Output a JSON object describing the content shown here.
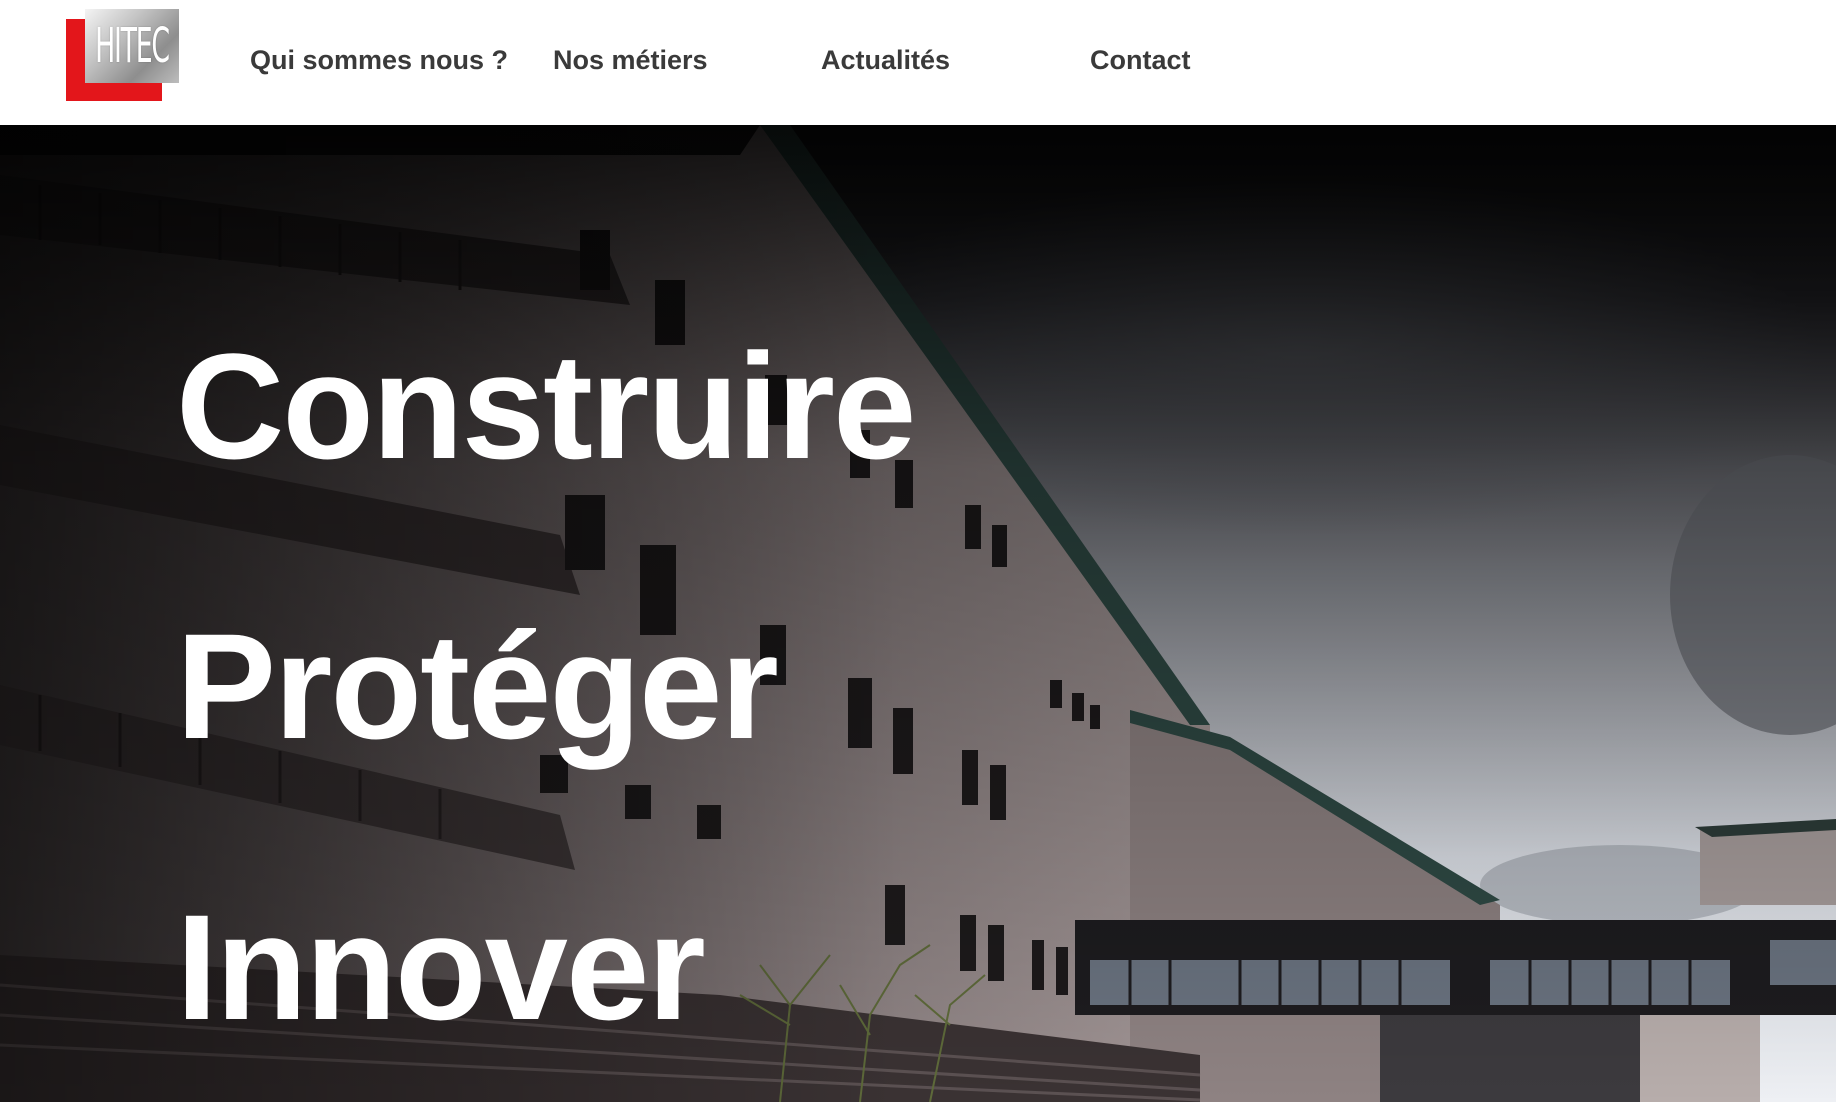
{
  "brand": {
    "logo_text": "HITEC",
    "logo_icon": "hitec-logo",
    "colors": {
      "red": "#e3161b",
      "grey": "#9a9a9a"
    }
  },
  "nav": {
    "items": [
      {
        "label": "Qui sommes nous ?"
      },
      {
        "label": "Nos métiers"
      },
      {
        "label": "Actualités"
      },
      {
        "label": "Contact"
      }
    ]
  },
  "hero": {
    "lines": [
      "Construire",
      "Protéger",
      "Innover"
    ],
    "image": "building-photo",
    "text_color": "#ffffff"
  }
}
